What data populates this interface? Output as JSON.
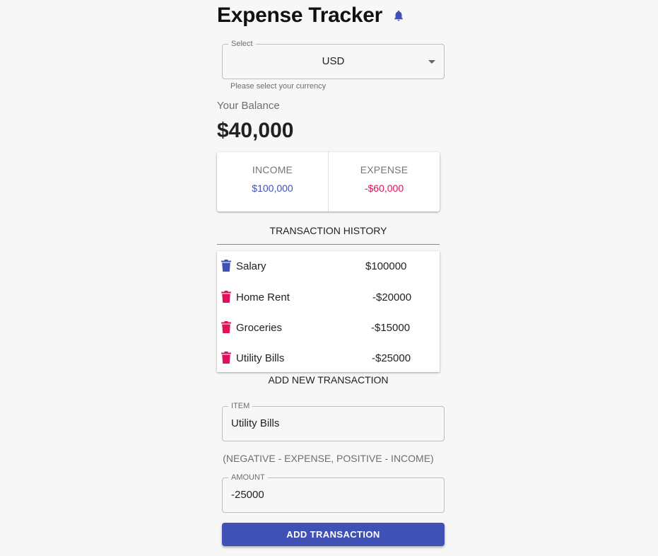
{
  "header": {
    "title": "Expense Tracker",
    "icon": "bell-icon"
  },
  "currency": {
    "label": "Select",
    "value": "USD",
    "helper": "Please select your currency"
  },
  "balance": {
    "label": "Your Balance",
    "amount": "$40,000"
  },
  "summary": {
    "income_label": "INCOME",
    "income_value": "$100,000",
    "expense_label": "EXPENSE",
    "expense_value": "-$60,000"
  },
  "history": {
    "title": "TRANSACTION HISTORY",
    "items": [
      {
        "name": "Salary",
        "amount": "$100000",
        "type": "income"
      },
      {
        "name": "Home Rent",
        "amount": "-$20000",
        "type": "expense"
      },
      {
        "name": "Groceries",
        "amount": "-$15000",
        "type": "expense"
      },
      {
        "name": "Utility Bills",
        "amount": "-$25000",
        "type": "expense"
      }
    ]
  },
  "form": {
    "title": "ADD NEW TRANSACTION",
    "item_label": "ITEM",
    "item_value": "Utility Bills",
    "hint": "(NEGATIVE - EXPENSE, POSITIVE - INCOME)",
    "amount_label": "AMOUNT",
    "amount_value": "-25000",
    "submit_label": "ADD TRANSACTION"
  },
  "colors": {
    "accent": "#3f51b5",
    "expense": "#e0105e",
    "background": "#f7f7f7"
  }
}
